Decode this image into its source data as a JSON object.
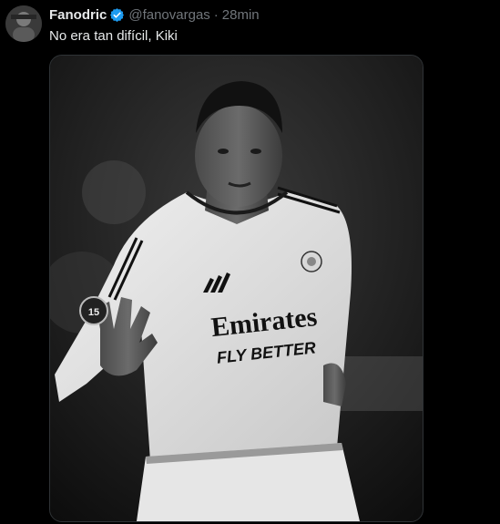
{
  "tweet": {
    "author_name": "Fanodric",
    "handle": "@fanovargas",
    "separator": "·",
    "time": "28min",
    "text": "No era tan difícil, Kiki"
  },
  "media": {
    "kit_sponsor": "Emirates",
    "kit_slogan": "FLY BETTER",
    "sleeve_badge_number": "15"
  },
  "colors": {
    "background": "#000000",
    "text_primary": "#e7e9ea",
    "text_secondary": "#71767b",
    "verified_blue": "#1d9bf0"
  },
  "icons": {
    "verified": "verified-badge-icon"
  }
}
